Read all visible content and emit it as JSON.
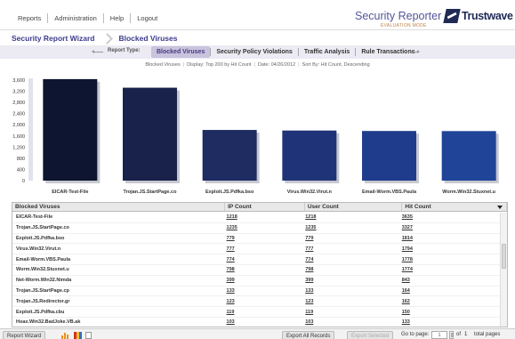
{
  "nav": {
    "items": [
      "Reports",
      "Administration",
      "Help",
      "Logout"
    ]
  },
  "brand": {
    "title": "Security Reporter",
    "subtitle": "EVALUATION MODE",
    "logo_text": "Trustwave"
  },
  "breadcrumb": {
    "root": "Security Report Wizard",
    "current": "Blocked Viruses"
  },
  "report_type": {
    "label": "Report Type:",
    "tabs": [
      {
        "label": "Blocked Viruses",
        "active": true
      },
      {
        "label": "Security Policy Violations",
        "active": false
      },
      {
        "label": "Traffic Analysis",
        "active": false
      },
      {
        "label": "Rule Transactions",
        "active": false
      }
    ]
  },
  "info": {
    "name": "Blocked Viruses",
    "display": "Display: Top 200 by Hit Count",
    "date": "Date: 04/26/2012",
    "sort": "Sort By: Hit Count, Descending"
  },
  "chart_data": {
    "type": "bar",
    "categories": [
      "EICAR-Test-File",
      "Trojan.JS.StartPage.co",
      "Exploit.JS.Pdfka.bso",
      "Virus.Win32.Virut.n",
      "Email-Worm.VBS.Paula",
      "Worm.Win32.Stuxnet.u"
    ],
    "values": [
      3635,
      3327,
      1814,
      1794,
      1778,
      1774
    ],
    "ylim": [
      0,
      3600
    ],
    "yticks": [
      "0",
      "400",
      "800",
      "1,200",
      "1,600",
      "2,000",
      "2,400",
      "2,800",
      "3,200",
      "3,600"
    ],
    "grid": false,
    "colors": [
      "#0d1530",
      "#18224a",
      "#1e2c62",
      "#1f3478",
      "#1f3c8c",
      "#1f4498"
    ]
  },
  "table": {
    "columns": [
      "Blocked Viruses",
      "IP Count",
      "User Count",
      "Hit Count"
    ],
    "rows": [
      [
        "EICAR-Test-File",
        "1218",
        "1218",
        "3635"
      ],
      [
        "Trojan.JS.StartPage.co",
        "1235",
        "1235",
        "3327"
      ],
      [
        "Exploit.JS.Pdfka.bso",
        "779",
        "779",
        "1814"
      ],
      [
        "Virus.Win32.Virut.n",
        "777",
        "777",
        "1794"
      ],
      [
        "Email-Worm.VBS.Paula",
        "774",
        "774",
        "1778"
      ],
      [
        "Worm.Win32.Stuxnet.u",
        "798",
        "798",
        "1774"
      ],
      [
        "Net-Worm.Win32.Nimda",
        "399",
        "399",
        "843"
      ],
      [
        "Trojan.JS.StartPage.cp",
        "133",
        "133",
        "164"
      ],
      [
        "Trojan.JS.Redirector.gr",
        "123",
        "123",
        "162"
      ],
      [
        "Exploit.JS.Pdfka.cbu",
        "119",
        "119",
        "150"
      ],
      [
        "Hoax.Win32.BadJoke.VB.ak",
        "103",
        "103",
        "133"
      ]
    ]
  },
  "footer": {
    "wizard_button": "Report Wizard",
    "export_all": "Export All Records",
    "export_selected": "Export Selected",
    "goto_label": "Go to page:",
    "page": "1",
    "of_label": "of",
    "total_pages": "1",
    "total_label": "total pages"
  }
}
